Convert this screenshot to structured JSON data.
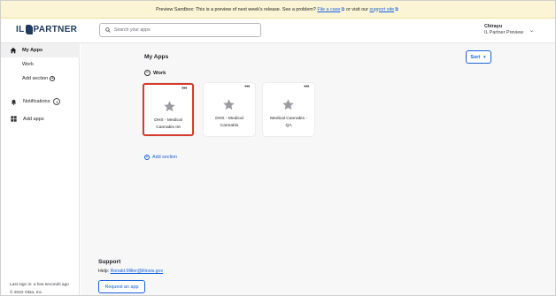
{
  "banner": {
    "text": "Preview Sandbox: This is a preview of next week's release. See a problem?",
    "link1": "File a case",
    "middle": "or visit our",
    "link2": "support site"
  },
  "header": {
    "logo_left": "IL",
    "logo_right": "PARTNER",
    "search_placeholder": "Search your apps",
    "user_name": "Chirayu",
    "user_org": "IL Partner Preview"
  },
  "sidebar": {
    "my_apps": "My Apps",
    "work": "Work",
    "add_section": "Add section",
    "notifications": "Notifications",
    "notifications_count": "1",
    "add_apps": "Add apps",
    "last_sign_in": "Last sign in: a few seconds ago",
    "copyright": "© 2022 Okta, Inc."
  },
  "main": {
    "title": "My Apps",
    "sort_label": "Sort",
    "section_name": "Work",
    "tiles": [
      {
        "line1": "DHS - Medical",
        "line2": "Cannabis Int"
      },
      {
        "line1": "DHS - Medical",
        "line2": "Cannabis"
      },
      {
        "line1": "Medical Cannabis -",
        "line2": "QA"
      }
    ],
    "add_section": "Add section",
    "support_title": "Support",
    "help_label": "Help:",
    "help_email": "Ronald.Miller@illinois.gov",
    "request_button": "Request an app"
  },
  "colors": {
    "accent": "#1662dd",
    "banner_bg": "#fbf5d6",
    "selected_border": "#d63b2f",
    "logo": "#1e3a60"
  }
}
